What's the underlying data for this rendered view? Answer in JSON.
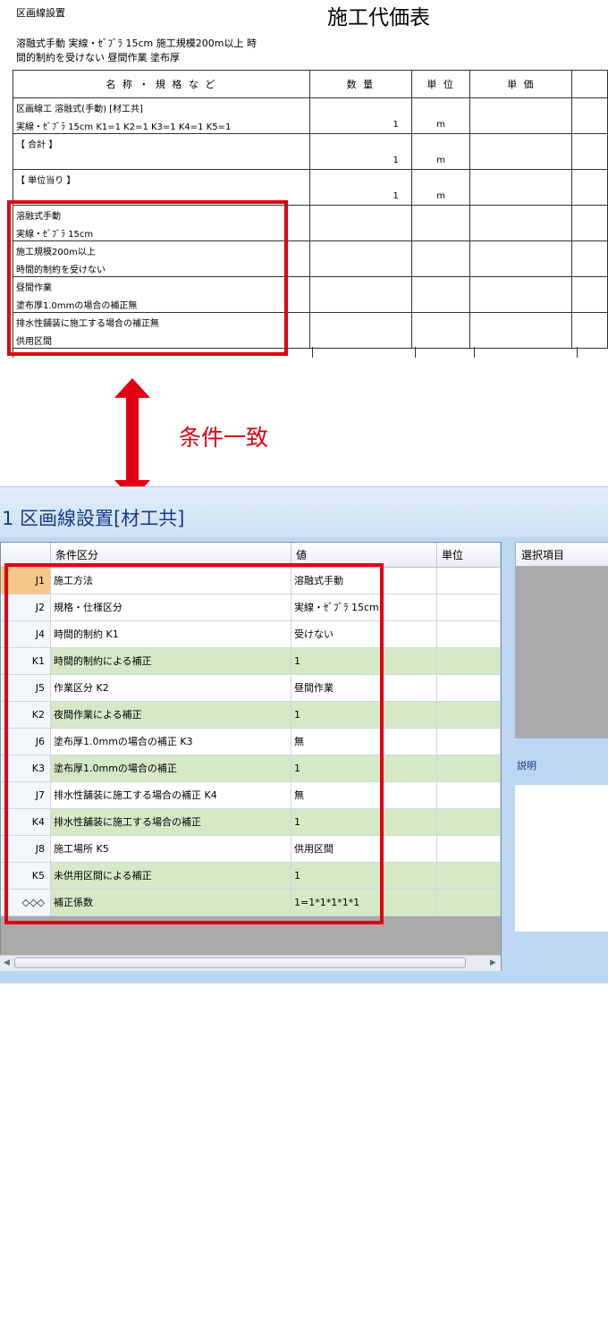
{
  "document": {
    "header_left": "区画線設置",
    "title": "施工代価表",
    "desc_line1": "溶融式手動 実線・ｾﾞﾌﾞﾗ 15cm 施工規模200m以上 時",
    "desc_line2": "間的制約を受けない 昼間作業 塗布厚",
    "table_headers": [
      "名 称 ・ 規 格 な ど",
      "数 量",
      "単 位",
      "単 価"
    ],
    "rows": [
      {
        "line1": "区画線工 溶融式(手動) [材工共]",
        "line2": "実線・ｾﾞﾌﾞﾗ 15cm K1=1 K2=1 K3=1 K4=1 K5=1",
        "qty": "1",
        "unit": "m"
      },
      {
        "line1": "【 合計 】",
        "line2": "",
        "qty": "1",
        "unit": "m"
      },
      {
        "line1": "【 単位当り 】",
        "line2": "",
        "qty": "1",
        "unit": "m"
      },
      {
        "line1": "溶融式手動",
        "line2": "実線・ｾﾞﾌﾞﾗ 15cm",
        "qty": "",
        "unit": ""
      },
      {
        "line1": "施工規模200m以上",
        "line2": "時間的制約を受けない",
        "qty": "",
        "unit": ""
      },
      {
        "line1": "昼間作業",
        "line2": "塗布厚1.0mmの場合の補正無",
        "qty": "",
        "unit": ""
      },
      {
        "line1": "排水性舗装に施工する場合の補正無",
        "line2": "供用区間",
        "qty": "",
        "unit": ""
      }
    ]
  },
  "annotation": {
    "match_label": "条件一致",
    "highlight_color": "#e00012"
  },
  "app": {
    "title": "1 区画線設置[材工共]",
    "grid_headers": [
      "条件区分",
      "値",
      "単位"
    ],
    "rows": [
      {
        "code": "J1",
        "label": "施工方法",
        "value": "溶融式手動",
        "unit": "",
        "style": "white",
        "active": true
      },
      {
        "code": "J2",
        "label": "規格・仕様区分",
        "value": "実線・ｾﾞﾌﾞﾗ 15cm",
        "unit": "",
        "style": "white"
      },
      {
        "code": "J4",
        "label": "時間的制約 K1",
        "value": "受けない",
        "unit": "",
        "style": "white"
      },
      {
        "code": "K1",
        "label": "時間的制約による補正",
        "value": "1",
        "unit": "",
        "style": "green"
      },
      {
        "code": "J5",
        "label": "作業区分 K2",
        "value": "昼間作業",
        "unit": "",
        "style": "white"
      },
      {
        "code": "K2",
        "label": "夜間作業による補正",
        "value": "1",
        "unit": "",
        "style": "green"
      },
      {
        "code": "J6",
        "label": "塗布厚1.0mmの場合の補正 K3",
        "value": "無",
        "unit": "",
        "style": "white"
      },
      {
        "code": "K3",
        "label": "塗布厚1.0mmの場合の補正",
        "value": "1",
        "unit": "",
        "style": "green"
      },
      {
        "code": "J7",
        "label": "排水性舗装に施工する場合の補正 K4",
        "value": "無",
        "unit": "",
        "style": "white"
      },
      {
        "code": "K4",
        "label": "排水性舗装に施工する場合の補正",
        "value": "1",
        "unit": "",
        "style": "green"
      },
      {
        "code": "J8",
        "label": "施工場所 K5",
        "value": "供用区間",
        "unit": "",
        "style": "white"
      },
      {
        "code": "K5",
        "label": "未供用区間による補正",
        "value": "1",
        "unit": "",
        "style": "green"
      },
      {
        "code": "◇◇◇",
        "label": "補正係数",
        "value": "1=1*1*1*1*1",
        "unit": "",
        "style": "green"
      }
    ],
    "side_header": "選択項目",
    "desc_label": "説明"
  }
}
